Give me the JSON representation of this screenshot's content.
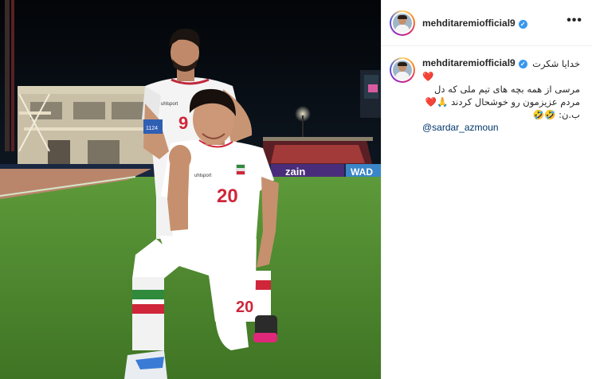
{
  "post": {
    "username": "mehditaremiofficial9",
    "verified_glyph": "✓",
    "more_glyph": "•••"
  },
  "photo": {
    "stadium_sign_1": "zain",
    "stadium_sign_2": "WAD",
    "player_front_number": "20",
    "player_back_number": "9",
    "shorts_number": "20",
    "armband_text": "1124",
    "sponsor": "uhlsport"
  },
  "caption": {
    "line1": "خدایا شکرت",
    "line2_heart": "❤️",
    "line3": "مرسی از همه بچه های تیم ملی که دل",
    "line4_emoji": "🙏❤️",
    "line4_text": "مردم عزیزمون رو خوشحال کردند",
    "line5": "ب.ن: 🤣🤣",
    "mention": "@sardar_azmoun"
  },
  "icons": {
    "verified": "verified-badge-icon",
    "more": "more-options-icon",
    "heart": "red-heart-emoji"
  },
  "colors": {
    "verified_blue": "#3897f0",
    "mention_blue": "#00376b",
    "heart_red": "#ed4956",
    "grass": "#4f8a2e"
  }
}
